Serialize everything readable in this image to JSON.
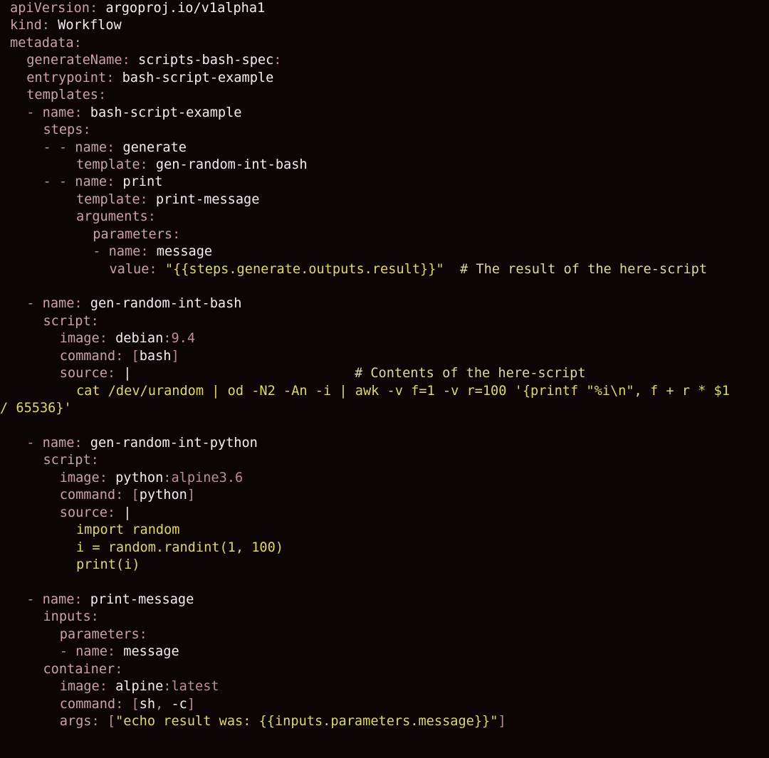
{
  "document": {
    "kind": "yaml-source-listing",
    "title": "Argo Workflow - scripts-bash-spec",
    "language": "yaml",
    "background_color": "#0d0406",
    "colors": {
      "key": "#c8a2ad",
      "punctuation": "#b88f9b",
      "value": "#f5eef0",
      "string": "#ddd96a",
      "comment": "#ddd8a0",
      "background": "#0d0406"
    }
  },
  "lines": [
    {
      "id": "l1",
      "indent": 0,
      "tokens": [
        {
          "t": "apiVersion",
          "c": "k"
        },
        {
          "t": ": ",
          "c": "p"
        },
        {
          "t": "argoproj.io/v1alpha1",
          "c": "v"
        }
      ]
    },
    {
      "id": "l2",
      "indent": 0,
      "tokens": [
        {
          "t": "kind",
          "c": "k"
        },
        {
          "t": ": ",
          "c": "p"
        },
        {
          "t": "Workflow",
          "c": "v"
        }
      ]
    },
    {
      "id": "l3",
      "indent": 0,
      "tokens": [
        {
          "t": "metadata",
          "c": "k"
        },
        {
          "t": ":",
          "c": "p"
        }
      ]
    },
    {
      "id": "l4",
      "indent": 2,
      "tokens": [
        {
          "t": "generateName",
          "c": "k"
        },
        {
          "t": ": ",
          "c": "p"
        },
        {
          "t": "scripts-bash-spec",
          "c": "v"
        },
        {
          "t": ":",
          "c": "p"
        }
      ]
    },
    {
      "id": "l5",
      "indent": 2,
      "tokens": [
        {
          "t": "entrypoint",
          "c": "k"
        },
        {
          "t": ": ",
          "c": "p"
        },
        {
          "t": "bash-script-example",
          "c": "v"
        }
      ]
    },
    {
      "id": "l6",
      "indent": 2,
      "tokens": [
        {
          "t": "templates",
          "c": "k"
        },
        {
          "t": ":",
          "c": "p"
        }
      ]
    },
    {
      "id": "l7",
      "indent": 2,
      "tokens": [
        {
          "t": "- ",
          "c": "p"
        },
        {
          "t": "name",
          "c": "k"
        },
        {
          "t": ": ",
          "c": "p"
        },
        {
          "t": "bash-script-example",
          "c": "v"
        }
      ]
    },
    {
      "id": "l8",
      "indent": 4,
      "tokens": [
        {
          "t": "steps",
          "c": "k"
        },
        {
          "t": ":",
          "c": "p"
        }
      ]
    },
    {
      "id": "l9",
      "indent": 4,
      "tokens": [
        {
          "t": "- - ",
          "c": "p"
        },
        {
          "t": "name",
          "c": "k"
        },
        {
          "t": ": ",
          "c": "p"
        },
        {
          "t": "generate",
          "c": "v"
        }
      ]
    },
    {
      "id": "l10",
      "indent": 8,
      "tokens": [
        {
          "t": "template",
          "c": "k"
        },
        {
          "t": ": ",
          "c": "p"
        },
        {
          "t": "gen-random-int-bash",
          "c": "v"
        }
      ]
    },
    {
      "id": "l11",
      "indent": 4,
      "tokens": [
        {
          "t": "- - ",
          "c": "p"
        },
        {
          "t": "name",
          "c": "k"
        },
        {
          "t": ": ",
          "c": "p"
        },
        {
          "t": "print",
          "c": "v"
        }
      ]
    },
    {
      "id": "l12",
      "indent": 8,
      "tokens": [
        {
          "t": "template",
          "c": "k"
        },
        {
          "t": ": ",
          "c": "p"
        },
        {
          "t": "print-message",
          "c": "v"
        }
      ]
    },
    {
      "id": "l13",
      "indent": 8,
      "tokens": [
        {
          "t": "arguments",
          "c": "k"
        },
        {
          "t": ":",
          "c": "p"
        }
      ]
    },
    {
      "id": "l14",
      "indent": 10,
      "tokens": [
        {
          "t": "parameters",
          "c": "k"
        },
        {
          "t": ":",
          "c": "p"
        }
      ]
    },
    {
      "id": "l15",
      "indent": 10,
      "tokens": [
        {
          "t": "- ",
          "c": "p"
        },
        {
          "t": "name",
          "c": "k"
        },
        {
          "t": ": ",
          "c": "p"
        },
        {
          "t": "message",
          "c": "v"
        }
      ]
    },
    {
      "id": "l16",
      "indent": 12,
      "tokens": [
        {
          "t": "value",
          "c": "k"
        },
        {
          "t": ": ",
          "c": "p"
        },
        {
          "t": "\"{{steps.generate.outputs.result}}\"",
          "c": "s"
        },
        {
          "t": "  ",
          "c": "gap"
        },
        {
          "t": "# The result of the here-script",
          "c": "c"
        }
      ]
    },
    {
      "id": "l17",
      "indent": 0,
      "blank": true,
      "tokens": []
    },
    {
      "id": "l18",
      "indent": 2,
      "tokens": [
        {
          "t": "- ",
          "c": "p"
        },
        {
          "t": "name",
          "c": "k"
        },
        {
          "t": ": ",
          "c": "p"
        },
        {
          "t": "gen-random-int-bash",
          "c": "v"
        }
      ]
    },
    {
      "id": "l19",
      "indent": 4,
      "tokens": [
        {
          "t": "script",
          "c": "k"
        },
        {
          "t": ":",
          "c": "p"
        }
      ]
    },
    {
      "id": "l20",
      "indent": 6,
      "tokens": [
        {
          "t": "image",
          "c": "k"
        },
        {
          "t": ": ",
          "c": "p"
        },
        {
          "t": "debian",
          "c": "v"
        },
        {
          "t": ":9.4",
          "c": "p"
        }
      ]
    },
    {
      "id": "l21",
      "indent": 6,
      "tokens": [
        {
          "t": "command",
          "c": "k"
        },
        {
          "t": ": ",
          "c": "p"
        },
        {
          "t": "[",
          "c": "p"
        },
        {
          "t": "bash",
          "c": "v"
        },
        {
          "t": "]",
          "c": "p"
        }
      ]
    },
    {
      "id": "l22",
      "indent": 6,
      "tokens": [
        {
          "t": "source",
          "c": "k"
        },
        {
          "t": ": ",
          "c": "p"
        },
        {
          "t": "|",
          "c": "tag"
        },
        {
          "t": "                            ",
          "c": "gap"
        },
        {
          "t": "# Contents of the here-script",
          "c": "c"
        }
      ]
    },
    {
      "id": "l23",
      "indent": 8,
      "tokens": [
        {
          "t": "cat /dev/urandom | od -N2 -An -i | awk -v f=1 -v r=100 '{printf \"%i\\n\", f + r * $1",
          "c": "s"
        }
      ]
    },
    {
      "id": "l24",
      "indent": 0,
      "wrap": true,
      "tokens": [
        {
          "t": "/ 65536}'",
          "c": "s"
        }
      ]
    },
    {
      "id": "l25",
      "indent": 0,
      "blank": true,
      "tokens": []
    },
    {
      "id": "l26",
      "indent": 2,
      "tokens": [
        {
          "t": "- ",
          "c": "p"
        },
        {
          "t": "name",
          "c": "k"
        },
        {
          "t": ": ",
          "c": "p"
        },
        {
          "t": "gen-random-int-python",
          "c": "v"
        }
      ]
    },
    {
      "id": "l27",
      "indent": 4,
      "tokens": [
        {
          "t": "script",
          "c": "k"
        },
        {
          "t": ":",
          "c": "p"
        }
      ]
    },
    {
      "id": "l28",
      "indent": 6,
      "tokens": [
        {
          "t": "image",
          "c": "k"
        },
        {
          "t": ": ",
          "c": "p"
        },
        {
          "t": "python",
          "c": "v"
        },
        {
          "t": ":alpine3.6",
          "c": "p"
        }
      ]
    },
    {
      "id": "l29",
      "indent": 6,
      "tokens": [
        {
          "t": "command",
          "c": "k"
        },
        {
          "t": ": ",
          "c": "p"
        },
        {
          "t": "[",
          "c": "p"
        },
        {
          "t": "python",
          "c": "v"
        },
        {
          "t": "]",
          "c": "p"
        }
      ]
    },
    {
      "id": "l30",
      "indent": 6,
      "tokens": [
        {
          "t": "source",
          "c": "k"
        },
        {
          "t": ": ",
          "c": "p"
        },
        {
          "t": "|",
          "c": "tag"
        }
      ]
    },
    {
      "id": "l31",
      "indent": 8,
      "tokens": [
        {
          "t": "import random",
          "c": "s"
        }
      ]
    },
    {
      "id": "l32",
      "indent": 8,
      "tokens": [
        {
          "t": "i = random.randint(1, 100)",
          "c": "s"
        }
      ]
    },
    {
      "id": "l33",
      "indent": 8,
      "tokens": [
        {
          "t": "print(i)",
          "c": "s"
        }
      ]
    },
    {
      "id": "l34",
      "indent": 0,
      "blank": true,
      "tokens": []
    },
    {
      "id": "l35",
      "indent": 2,
      "tokens": [
        {
          "t": "- ",
          "c": "p"
        },
        {
          "t": "name",
          "c": "k"
        },
        {
          "t": ": ",
          "c": "p"
        },
        {
          "t": "print-message",
          "c": "v"
        }
      ]
    },
    {
      "id": "l36",
      "indent": 4,
      "tokens": [
        {
          "t": "inputs",
          "c": "k"
        },
        {
          "t": ":",
          "c": "p"
        }
      ]
    },
    {
      "id": "l37",
      "indent": 6,
      "tokens": [
        {
          "t": "parameters",
          "c": "k"
        },
        {
          "t": ":",
          "c": "p"
        }
      ]
    },
    {
      "id": "l38",
      "indent": 6,
      "tokens": [
        {
          "t": "- ",
          "c": "p"
        },
        {
          "t": "name",
          "c": "k"
        },
        {
          "t": ": ",
          "c": "p"
        },
        {
          "t": "message",
          "c": "v"
        }
      ]
    },
    {
      "id": "l39",
      "indent": 4,
      "tokens": [
        {
          "t": "container",
          "c": "k"
        },
        {
          "t": ":",
          "c": "p"
        }
      ]
    },
    {
      "id": "l40",
      "indent": 6,
      "tokens": [
        {
          "t": "image",
          "c": "k"
        },
        {
          "t": ": ",
          "c": "p"
        },
        {
          "t": "alpine",
          "c": "v"
        },
        {
          "t": ":latest",
          "c": "p"
        }
      ]
    },
    {
      "id": "l41",
      "indent": 6,
      "tokens": [
        {
          "t": "command",
          "c": "k"
        },
        {
          "t": ": ",
          "c": "p"
        },
        {
          "t": "[",
          "c": "p"
        },
        {
          "t": "sh",
          "c": "v"
        },
        {
          "t": ", ",
          "c": "p"
        },
        {
          "t": "-c",
          "c": "v"
        },
        {
          "t": "]",
          "c": "p"
        }
      ]
    },
    {
      "id": "l42",
      "indent": 6,
      "tokens": [
        {
          "t": "args",
          "c": "k"
        },
        {
          "t": ": ",
          "c": "p"
        },
        {
          "t": "[",
          "c": "p"
        },
        {
          "t": "\"echo result was: {{inputs.parameters.message}}\"",
          "c": "s"
        },
        {
          "t": "]",
          "c": "p"
        }
      ]
    }
  ]
}
